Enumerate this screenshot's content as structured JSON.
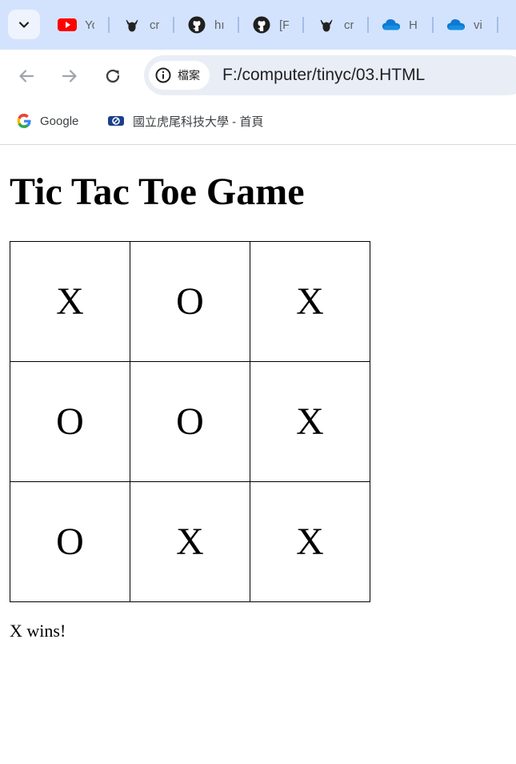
{
  "tabs": [
    {
      "title": "Yo",
      "icon": "youtube-icon"
    },
    {
      "title": "cr",
      "icon": "cat-icon"
    },
    {
      "title": "hı",
      "icon": "github-icon"
    },
    {
      "title": "[F",
      "icon": "github-icon"
    },
    {
      "title": "cr",
      "icon": "cat-icon"
    },
    {
      "title": "H",
      "icon": "onedrive-icon"
    },
    {
      "title": "vi",
      "icon": "onedrive-icon"
    }
  ],
  "omnibox": {
    "site_label": "檔案",
    "url": "F:/computer/tinyc/03.HTML"
  },
  "bookmarks": [
    {
      "label": "Google",
      "icon": "google-icon"
    },
    {
      "label": "國立虎尾科技大學 - 首頁",
      "icon": "university-logo-icon"
    }
  ],
  "page": {
    "title": "Tic Tac Toe Game",
    "board": [
      [
        "X",
        "O",
        "X"
      ],
      [
        "O",
        "O",
        "X"
      ],
      [
        "O",
        "X",
        "X"
      ]
    ],
    "status": "X wins!"
  },
  "colors": {
    "tabstrip_bg": "#d3e3fd",
    "omnibox_bg": "#e9eef6",
    "youtube_red": "#ff0000",
    "onedrive_blue": "#0f78d4"
  }
}
